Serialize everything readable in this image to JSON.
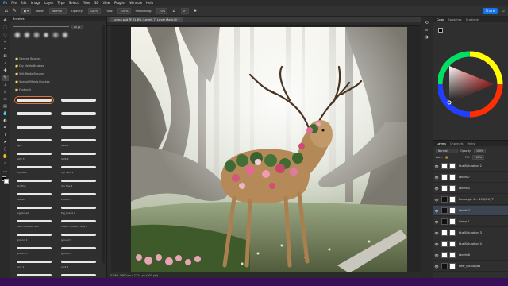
{
  "menu": [
    "Ps",
    "File",
    "Edit",
    "Image",
    "Layer",
    "Type",
    "Select",
    "Filter",
    "3D",
    "View",
    "Plugins",
    "Window",
    "Help"
  ],
  "options": {
    "mode_label": "Mode:",
    "mode_value": "Normal",
    "opacity_label": "Opacity:",
    "opacity_value": "100%",
    "flow_label": "Flow:",
    "flow_value": "100%",
    "smoothing_label": "Smoothing:",
    "smoothing_value": "10%",
    "angle_value": "0°",
    "share_label": "Share"
  },
  "document": {
    "tab_title": "scene.psd @ 51.8% (Levels 7, Layer Mask/8) *",
    "status": "51.8%    1600 px x 1124 px (300 ppi)"
  },
  "brushes": {
    "tab": "Brushes",
    "size_value": "90 px",
    "groups": [
      "General Brushes",
      "Dry Media Brushes",
      "Wet Media Brushes",
      "Special Effects Brushes",
      "Fanbrush"
    ],
    "items": [
      {
        "left": "",
        "right": ""
      },
      {
        "left": "",
        "right": ""
      },
      {
        "left": "",
        "right": ""
      },
      {
        "left": "light",
        "right": "light 2"
      },
      {
        "left": "light 3",
        "right": "light 4"
      },
      {
        "left": "dry hard",
        "right": "dry hard 2"
      },
      {
        "left": "dry fine",
        "right": "dry fine 2"
      },
      {
        "left": "CLOUD",
        "right": "CLOUD 2"
      },
      {
        "left": "fog_bread",
        "right": "fog_bread 2"
      },
      {
        "left": "EARTH SHORE SOFT",
        "right": "EARTH SHORE HEAVY"
      },
      {
        "left": "ground 1",
        "right": "ground 2"
      },
      {
        "left": "ground 3",
        "right": "ground 4"
      },
      {
        "left": "rock 1",
        "right": "rock 2"
      },
      {
        "left": "ground 5",
        "right": "ground 6"
      }
    ]
  },
  "color_panel": {
    "tabs": [
      "Color",
      "Swatches",
      "Gradients"
    ]
  },
  "layers_panel": {
    "tabs": [
      "Layers",
      "Channels",
      "Paths"
    ],
    "blend": "Normal",
    "opacity_label": "Opacity:",
    "opacity": "100%",
    "lock_label": "Lock:",
    "fill_label": "Fill:",
    "fill": "100%",
    "layers": [
      {
        "name": "Hue/Saturation 2",
        "dark": false
      },
      {
        "name": "Levels 7",
        "dark": false
      },
      {
        "name": "Levels 5",
        "dark": false
      },
      {
        "name": "Rectangle 1 ... 15 Q7.0,FP",
        "dark": true
      },
      {
        "name": "Levels 7",
        "dark": true
      },
      {
        "name": "Group 1",
        "dark": true
      },
      {
        "name": "Hue/Saturation 3",
        "dark": false
      },
      {
        "name": "Hue/Saturation 4",
        "dark": false
      },
      {
        "name": "Levels 6",
        "dark": false
      },
      {
        "name": "deer_cutout.psd",
        "dark": true
      }
    ]
  },
  "colors": {
    "accent": "#1473e6",
    "taskbar": "#3a0f5a",
    "selection": "#e07030"
  }
}
